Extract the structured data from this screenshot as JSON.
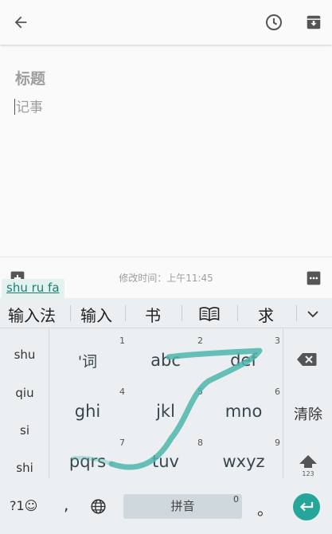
{
  "note": {
    "title_placeholder": "标题",
    "body_placeholder": "记事",
    "modified_text": "修改时间：上午11:45"
  },
  "ime": {
    "composing_text": "shu ru fa",
    "candidates": [
      "输入法",
      "输入",
      "书",
      "求"
    ],
    "pinyin_options": [
      "shu",
      "qiu",
      "si",
      "shi"
    ],
    "keys": [
      {
        "num": "1",
        "label": "'词"
      },
      {
        "num": "2",
        "label": "abc"
      },
      {
        "num": "3",
        "label": "def"
      },
      {
        "num": "4",
        "label": "ghi"
      },
      {
        "num": "5",
        "label": "jkl"
      },
      {
        "num": "6",
        "label": "mno"
      },
      {
        "num": "7",
        "label": "pqrs"
      },
      {
        "num": "8",
        "label": "tuv"
      },
      {
        "num": "9",
        "label": "wxyz"
      }
    ],
    "clear_label": "清除",
    "shift_label": "123",
    "symbols_label": "?1☺",
    "comma_label": ",",
    "space_label": "拼音",
    "space_num": "0",
    "period_label": "。"
  },
  "colors": {
    "accent": "#26a69a",
    "swipe_trail": "#4db6ac",
    "keyboard_bg": "#eceff1"
  },
  "icons": {
    "back": "arrow-left-icon",
    "reminder": "clock-icon",
    "archive": "archive-icon",
    "add": "add-box-icon",
    "more": "more-horizontal-icon",
    "dictionary": "book-icon",
    "collapse": "chevron-down-icon",
    "backspace": "backspace-icon",
    "shift": "shift-arrow-icon",
    "globe": "globe-icon",
    "enter": "enter-icon"
  }
}
